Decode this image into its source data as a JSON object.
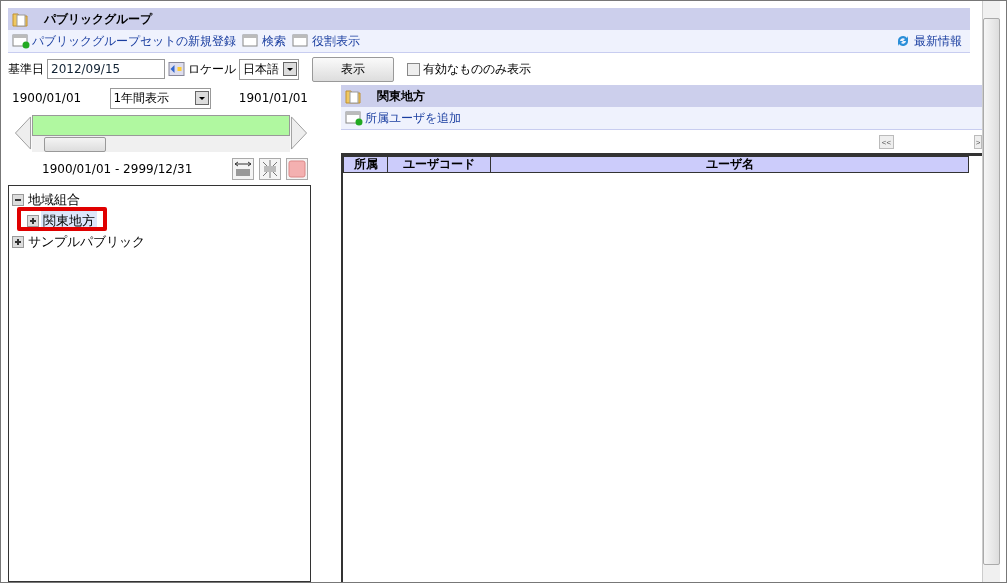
{
  "header": {
    "title": "パブリックグループ"
  },
  "toolbar": {
    "links": [
      "パブリックグループセットの新規登録",
      "検索",
      "役割表示"
    ],
    "refresh": "最新情報"
  },
  "filter": {
    "date_label": "基準日",
    "date_value": "2012/09/15",
    "locale_label": "ロケール",
    "locale_value": "日本語",
    "show_button": "表示",
    "valid_only": {
      "label": "有効なもののみ表示",
      "checked": false
    }
  },
  "timeline": {
    "start": "1900/01/01",
    "period": "1年間表示",
    "end": "1901/01/01",
    "level": 0.14,
    "range": "1900/01/01 - 2999/12/31"
  },
  "tree": [
    {
      "label": "地域組合",
      "expanded": true,
      "selected": false,
      "children": [
        {
          "label": "関東地方",
          "expanded": false,
          "selected": true,
          "highlighted": true
        }
      ]
    },
    {
      "label": "サンプルパブリック",
      "expanded": false,
      "selected": false
    }
  ],
  "detail": {
    "title": "関東地方",
    "add_link": "所属ユーザを追加",
    "prev_button": "<<",
    "next_button": ">",
    "columns": [
      "所属",
      "ユーザコード",
      "ユーザ名"
    ]
  }
}
